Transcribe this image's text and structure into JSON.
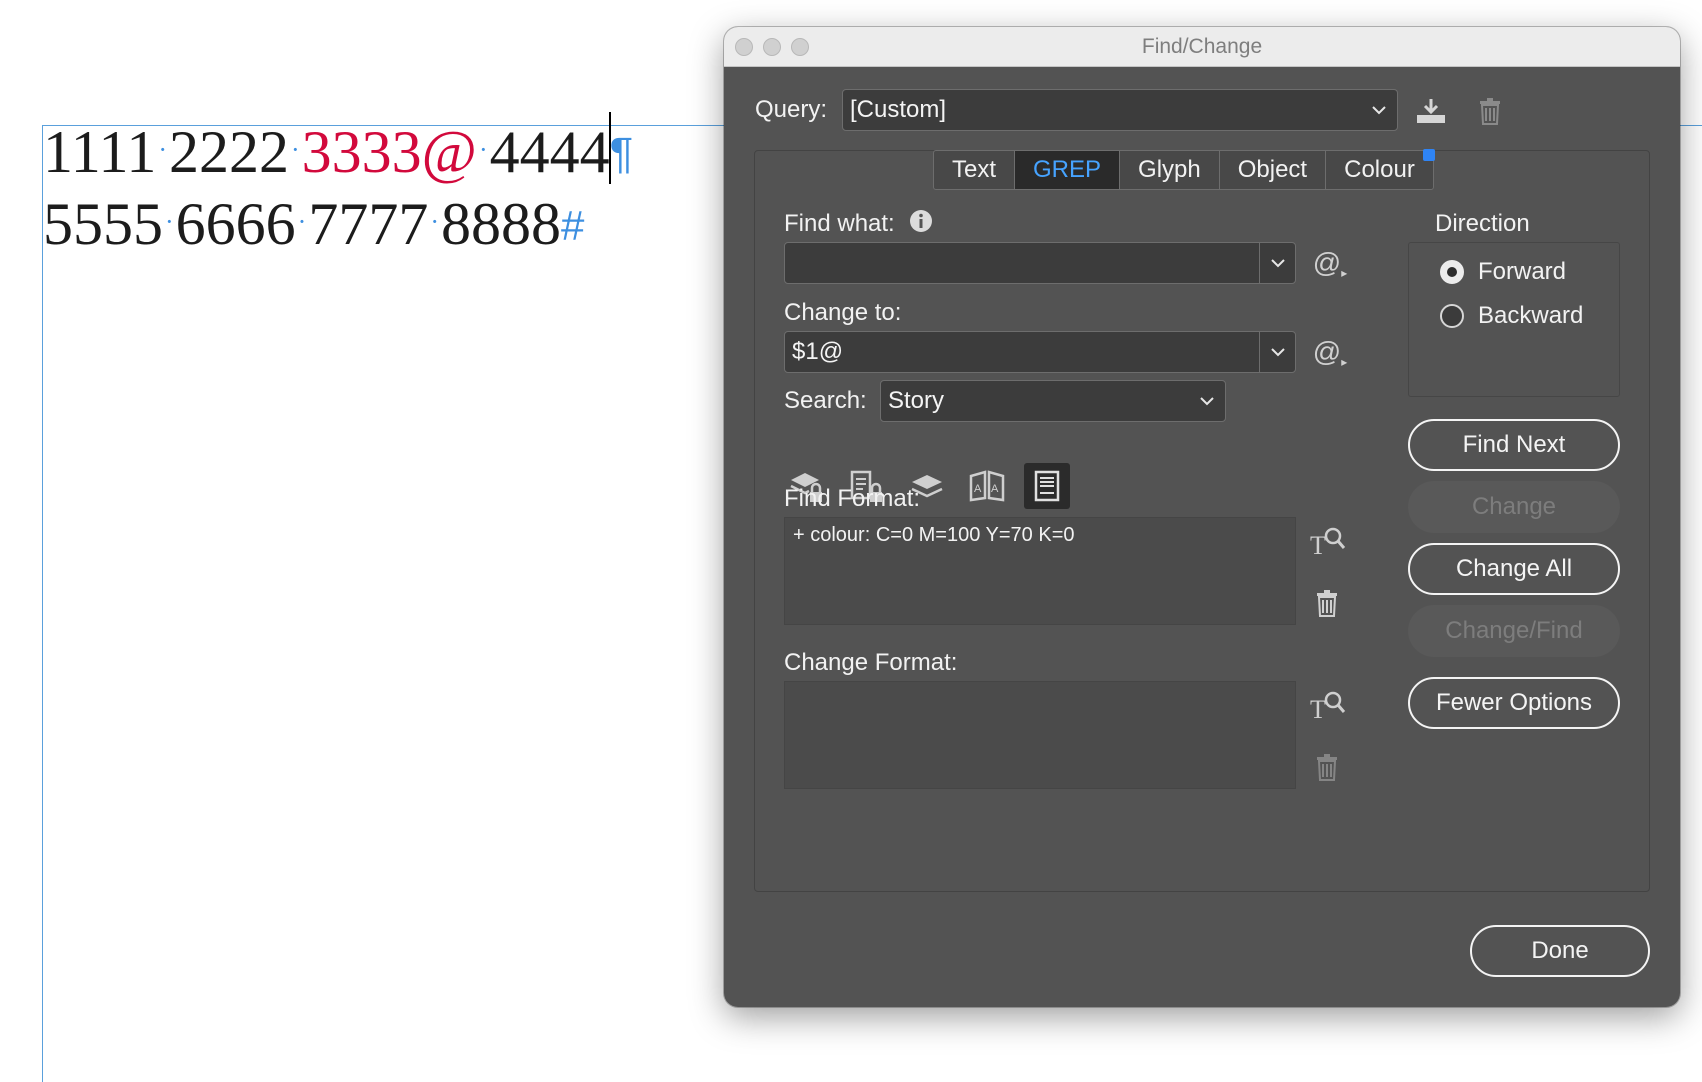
{
  "document": {
    "line1": {
      "n1": "1111",
      "n2": "2222",
      "n3": "3333@",
      "n4": "4444",
      "end_mark": "¶"
    },
    "line2": {
      "n1": "5555",
      "n2": "6666",
      "n3": "7777",
      "n4": "8888",
      "end_mark": "#"
    },
    "space_marker": "·",
    "highlight_color": "#d2093c",
    "guide_color": "#3d8fe0"
  },
  "dialog": {
    "title": "Find/Change",
    "query": {
      "label": "Query:",
      "value": "[Custom]"
    },
    "tabs": [
      {
        "label": "Text"
      },
      {
        "label": "GREP",
        "active": true
      },
      {
        "label": "Glyph"
      },
      {
        "label": "Object"
      },
      {
        "label": "Colour"
      }
    ],
    "find_what": {
      "label": "Find what:",
      "value": ""
    },
    "change_to": {
      "label": "Change to:",
      "value": "$1@"
    },
    "search": {
      "label": "Search:",
      "value": "Story"
    },
    "find_format": {
      "label": "Find Format:",
      "value": "+ colour: C=0 M=100 Y=70 K=0"
    },
    "change_format": {
      "label": "Change Format:",
      "value": ""
    },
    "direction": {
      "label": "Direction",
      "options": [
        {
          "label": "Forward",
          "selected": true
        },
        {
          "label": "Backward",
          "selected": false
        }
      ]
    },
    "buttons": {
      "find_next": "Find Next",
      "change": "Change",
      "change_all": "Change All",
      "change_find": "Change/Find",
      "fewer_options": "Fewer Options",
      "done": "Done"
    },
    "special_char_glyph": "@",
    "accent_color": "#46a3ff"
  }
}
